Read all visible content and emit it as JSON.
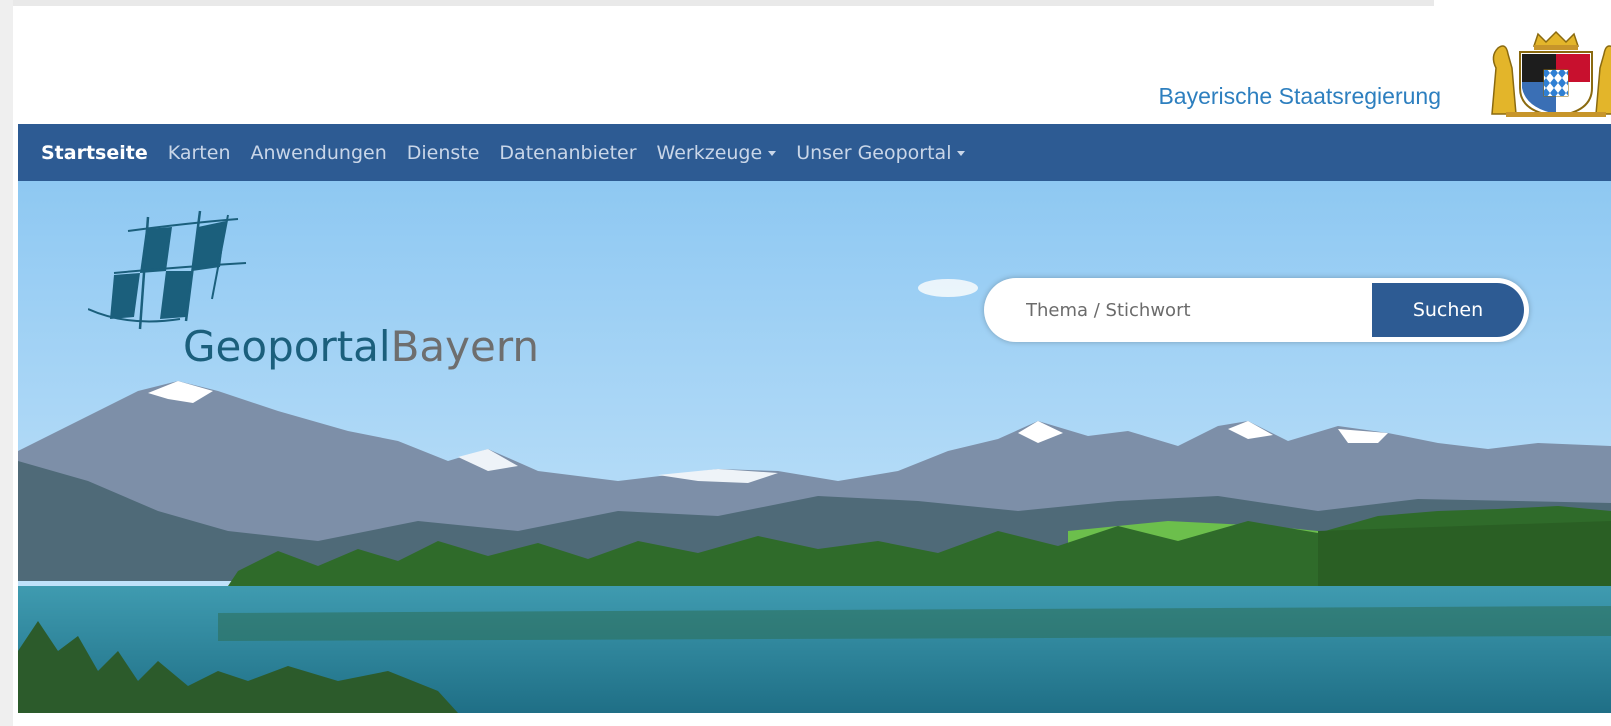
{
  "header": {
    "government_name": "Bayerische Staatsregierung",
    "coat_of_arms_icon": "bavarian-coat-of-arms-icon"
  },
  "nav": {
    "items": [
      {
        "label": "Startseite",
        "active": true,
        "dropdown": false
      },
      {
        "label": "Karten",
        "active": false,
        "dropdown": false
      },
      {
        "label": "Anwendungen",
        "active": false,
        "dropdown": false
      },
      {
        "label": "Dienste",
        "active": false,
        "dropdown": false
      },
      {
        "label": "Datenanbieter",
        "active": false,
        "dropdown": false
      },
      {
        "label": "Werkzeuge",
        "active": false,
        "dropdown": true
      },
      {
        "label": "Unser Geoportal",
        "active": false,
        "dropdown": true
      }
    ]
  },
  "logo": {
    "part1": "Geoportal",
    "part2": "Bayern"
  },
  "search": {
    "placeholder": "Thema / Stichwort",
    "button_label": "Suchen"
  },
  "colors": {
    "nav_bg": "#2d5b93",
    "accent_blue": "#2d7fbf",
    "logo_teal": "#1b5f7c"
  }
}
